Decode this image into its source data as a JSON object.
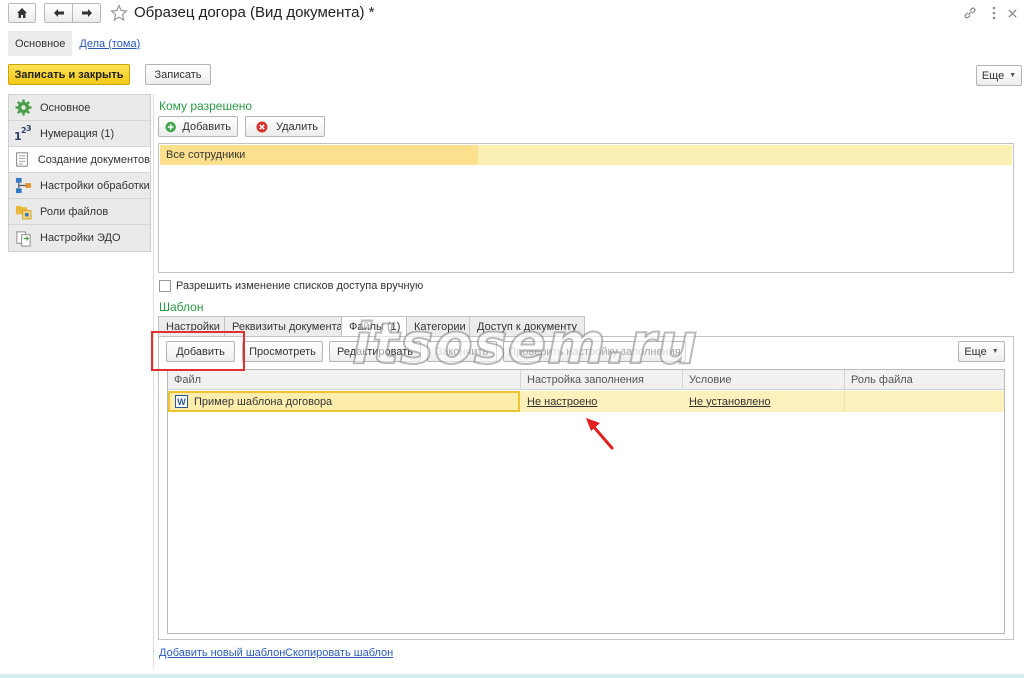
{
  "window": {
    "title": "Образец догора (Вид документа) *"
  },
  "section_tabs": [
    "Основное",
    "Дела (тома)"
  ],
  "toolbar": {
    "save_close": "Записать и закрыть",
    "save": "Записать",
    "more": "Еще"
  },
  "left_nav": [
    {
      "label": "Основное",
      "icon": "gear-icon"
    },
    {
      "label": "Нумерация (1)",
      "icon": "numbering-icon"
    },
    {
      "label": "Создание документов",
      "icon": "document-icon"
    },
    {
      "label": "Настройки обработки",
      "icon": "process-icon"
    },
    {
      "label": "Роли файлов",
      "icon": "file-roles-icon"
    },
    {
      "label": "Настройки ЭДО",
      "icon": "edo-icon"
    }
  ],
  "access": {
    "title": "Кому разрешено",
    "add": "Добавить",
    "remove": "Удалить",
    "rows": [
      "Все сотрудники"
    ],
    "checkbox_label": "Разрешить изменение списков доступа вручную"
  },
  "template": {
    "title": "Шаблон",
    "tabs": [
      "Настройки",
      "Реквизиты документа",
      "Файлы (1)",
      "Категории",
      "Доступ к документу"
    ],
    "buttons": {
      "add": "Добавить",
      "view": "Просмотреть",
      "edit": "Редактировать",
      "finish": "Закончить",
      "check": "Проверить настройку заполнения",
      "more": "Еще"
    },
    "columns": [
      "Файл",
      "Настройка заполнения",
      "Условие",
      "Роль файла"
    ],
    "rows": [
      {
        "file": "Пример шаблона договора",
        "fill": "Не настроено",
        "condition": "Не установлено",
        "role": ""
      }
    ]
  },
  "links": {
    "add_template": "Добавить новый шаблон",
    "copy_template": "Скопировать шаблон"
  },
  "watermark": "itsosem.ru",
  "colors": {
    "primary_button": "#f3c818",
    "group_title": "#2a9a45",
    "link": "#2a5ab8",
    "selection": "#fce08e",
    "highlight_rect": "#e03030"
  }
}
